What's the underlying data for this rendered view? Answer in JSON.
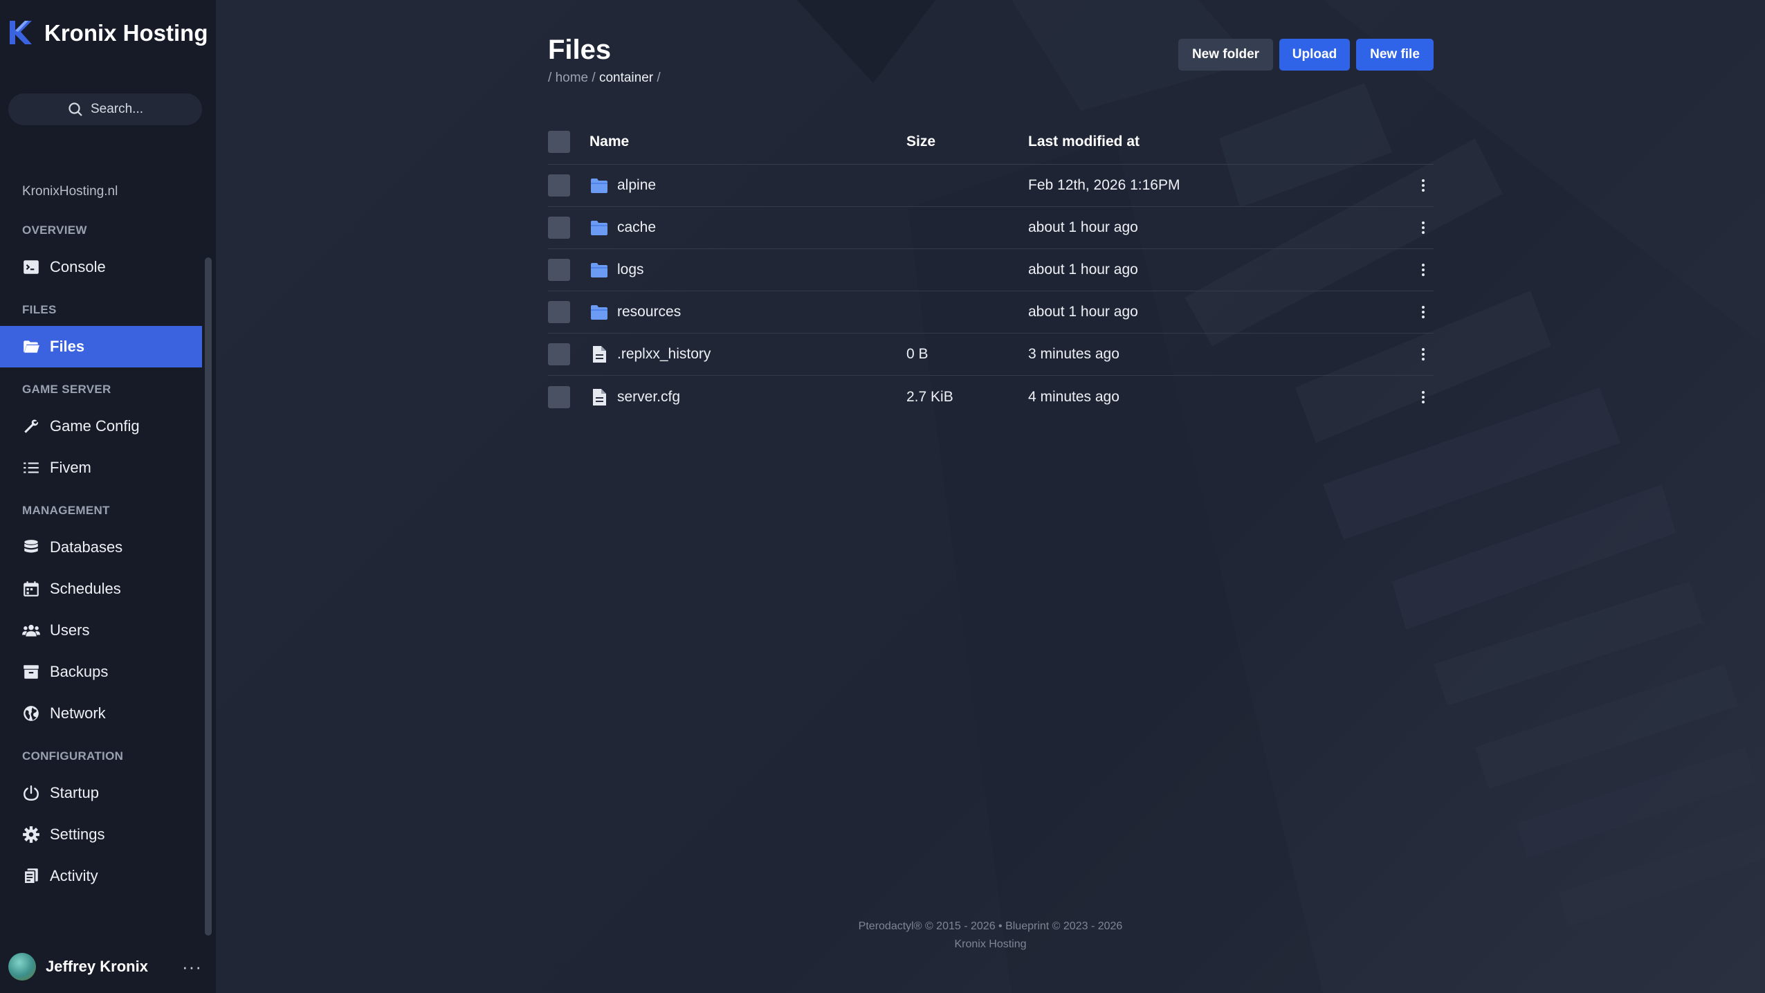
{
  "brand": {
    "name": "Kronix Hosting"
  },
  "search": {
    "placeholder": "Search..."
  },
  "sidebar": {
    "host_link": "KronixHosting.nl",
    "sections": {
      "overview": "OVERVIEW",
      "files": "FILES",
      "game_server": "GAME SERVER",
      "management": "MANAGEMENT",
      "configuration": "CONFIGURATION"
    },
    "items": {
      "console": "Console",
      "files": "Files",
      "game_config": "Game Config",
      "fivem": "Fivem",
      "databases": "Databases",
      "schedules": "Schedules",
      "users": "Users",
      "backups": "Backups",
      "network": "Network",
      "startup": "Startup",
      "settings": "Settings",
      "activity": "Activity"
    },
    "active_item": "Files"
  },
  "user": {
    "name": "Jeffrey Kronix",
    "menu": "···"
  },
  "page": {
    "title": "Files",
    "breadcrumb": {
      "sep1": "/",
      "home": "home",
      "sep2": "/",
      "container": "container",
      "sep3": "/"
    }
  },
  "toolbar": {
    "new_folder": "New folder",
    "upload": "Upload",
    "new_file": "New file"
  },
  "table": {
    "headers": {
      "name": "Name",
      "size": "Size",
      "modified": "Last modified at"
    },
    "rows": [
      {
        "type": "folder",
        "name": "alpine",
        "size": "",
        "modified": "Feb 12th, 2026 1:16PM"
      },
      {
        "type": "folder",
        "name": "cache",
        "size": "",
        "modified": "about 1 hour ago"
      },
      {
        "type": "folder",
        "name": "logs",
        "size": "",
        "modified": "about 1 hour ago"
      },
      {
        "type": "folder",
        "name": "resources",
        "size": "",
        "modified": "about 1 hour ago"
      },
      {
        "type": "file",
        "name": ".replxx_history",
        "size": "0 B",
        "modified": "3 minutes ago"
      },
      {
        "type": "file",
        "name": "server.cfg",
        "size": "2.7 KiB",
        "modified": "4 minutes ago"
      }
    ]
  },
  "footer": {
    "line1": "Pterodactyl® © 2015 - 2026  •  Blueprint © 2023 - 2026",
    "line2": "Kronix Hosting"
  },
  "colors": {
    "accent": "#3b63e0",
    "button_primary": "#2f63e8",
    "folder_icon": "#6b9bf2",
    "sidebar_bg": "#171b27",
    "main_bg": "#222838"
  }
}
